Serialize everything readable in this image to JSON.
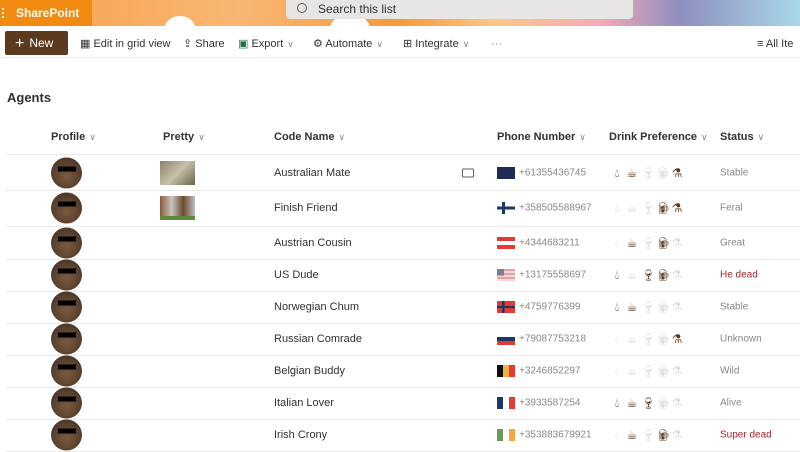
{
  "app": {
    "brand": "SharePoint",
    "search_placeholder": "Search this list"
  },
  "toolbar": {
    "new": "New",
    "edit_grid": "Edit in grid view",
    "share": "Share",
    "export": "Export",
    "automate": "Automate",
    "integrate": "Integrate",
    "more": "···",
    "view": "All Ite"
  },
  "list": {
    "title": "Agents"
  },
  "columns": [
    "Profile",
    "Pretty",
    "Code Name",
    "Phone Number",
    "Drink Preference",
    "Status"
  ],
  "drink_icons": [
    "water-drop-icon",
    "coffee-icon",
    "wine-glass-icon",
    "beer-mug-icon",
    "flask-icon"
  ],
  "colors": {
    "accent": "#5c3a1e",
    "dead": "#a4262c",
    "drink_on": "#5c3a1e",
    "drink_off": "#dedcda"
  },
  "rows": [
    {
      "code": "Australian Mate",
      "phone": "+61355436745",
      "flag": "australia",
      "drinks": [
        1,
        1,
        0,
        0,
        1
      ],
      "status": "Stable",
      "dead": false,
      "pretty": true,
      "comment": true
    },
    {
      "code": "Finish Friend",
      "phone": "+358505588967",
      "flag": "finland",
      "drinks": [
        0,
        0,
        0,
        1,
        1
      ],
      "status": "Feral",
      "dead": false,
      "pretty": true
    },
    {
      "code": "Austrian Cousin",
      "phone": "+4344683211",
      "flag": "austria",
      "drinks": [
        0,
        1,
        0,
        1,
        0
      ],
      "status": "Great",
      "dead": false
    },
    {
      "code": "US Dude",
      "phone": "+13175558697",
      "flag": "usa",
      "drinks": [
        1,
        0,
        1,
        1,
        0
      ],
      "status": "He dead",
      "dead": true
    },
    {
      "code": "Norwegian Chum",
      "phone": "+4759776399",
      "flag": "norway",
      "drinks": [
        1,
        1,
        0,
        0,
        0
      ],
      "status": "Stable",
      "dead": false
    },
    {
      "code": "Russian Comrade",
      "phone": "+79087753218",
      "flag": "russia",
      "drinks": [
        0,
        0,
        0,
        0,
        1
      ],
      "status": "Unknown",
      "dead": false
    },
    {
      "code": "Belgian Buddy",
      "phone": "+3246852297",
      "flag": "belgium",
      "drinks": [
        0,
        0,
        0,
        0,
        0
      ],
      "status": "Wild",
      "dead": false
    },
    {
      "code": "Italian Lover",
      "phone": "+3933587254",
      "flag": "italy",
      "drinks": [
        1,
        1,
        1,
        0,
        0
      ],
      "status": "Alive",
      "dead": false
    },
    {
      "code": "Irish Crony",
      "phone": "+353883679921",
      "flag": "ireland",
      "drinks": [
        0,
        1,
        0,
        1,
        0
      ],
      "status": "Super dead",
      "dead": true
    }
  ]
}
